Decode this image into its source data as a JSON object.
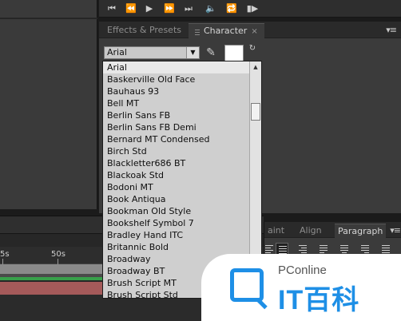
{
  "tabs": {
    "effects_presets": "Effects & Presets",
    "character": "Character",
    "close": "×"
  },
  "font_select": {
    "value": "Arial",
    "arrow": "▼"
  },
  "font_list": [
    "Arial",
    "Baskerville Old Face",
    "Bauhaus 93",
    "Bell MT",
    "Berlin Sans FB",
    "Berlin Sans FB Demi",
    "Bernard MT Condensed",
    "Birch Std",
    "Blackletter686 BT",
    "Blackoak Std",
    "Bodoni MT",
    "Book Antiqua",
    "Bookman Old Style",
    "Bookshelf Symbol 7",
    "Bradley Hand ITC",
    "Britannic Bold",
    "Broadway",
    "Broadway BT",
    "Brush Script MT",
    "Brush Script Std"
  ],
  "timeline": {
    "tick_5s": "5s",
    "tick_50s": "50s"
  },
  "paragraph_panel": {
    "tab_paint": "aint",
    "tab_align": "Align",
    "tab_paragraph": "Paragraph"
  },
  "watermark": {
    "brand_top": "PConline",
    "brand_main": "IT百科"
  },
  "colors": {
    "accent": "#1e8fe6",
    "timeline_green": "#37a04a",
    "timeline_red": "#a55a5a"
  }
}
